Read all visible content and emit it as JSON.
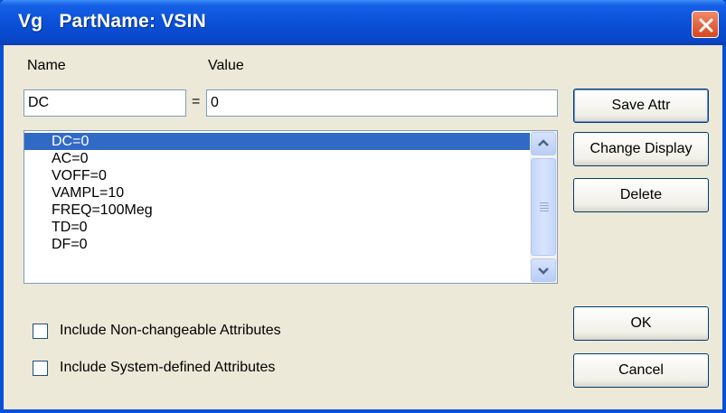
{
  "window": {
    "title": "Vg   PartName: VSIN"
  },
  "labels": {
    "name": "Name",
    "value": "Value",
    "equals": "="
  },
  "fields": {
    "name_value": "DC",
    "value_value": "0"
  },
  "attributes": [
    "DC=0",
    "AC=0",
    "VOFF=0",
    "VAMPL=10",
    "FREQ=100Meg",
    "TD=0",
    "DF=0"
  ],
  "selected_index": 0,
  "buttons": {
    "save_attr": "Save Attr",
    "change_display": "Change Display",
    "delete": "Delete",
    "ok": "OK",
    "cancel": "Cancel"
  },
  "checkboxes": {
    "non_changeable": {
      "label": "Include Non-changeable Attributes",
      "checked": false
    },
    "system_defined": {
      "label": "Include System-defined Attributes",
      "checked": false
    }
  },
  "colors": {
    "titlebar": "#0a50d8",
    "selection": "#316ac5",
    "close_button": "#d8451d"
  }
}
